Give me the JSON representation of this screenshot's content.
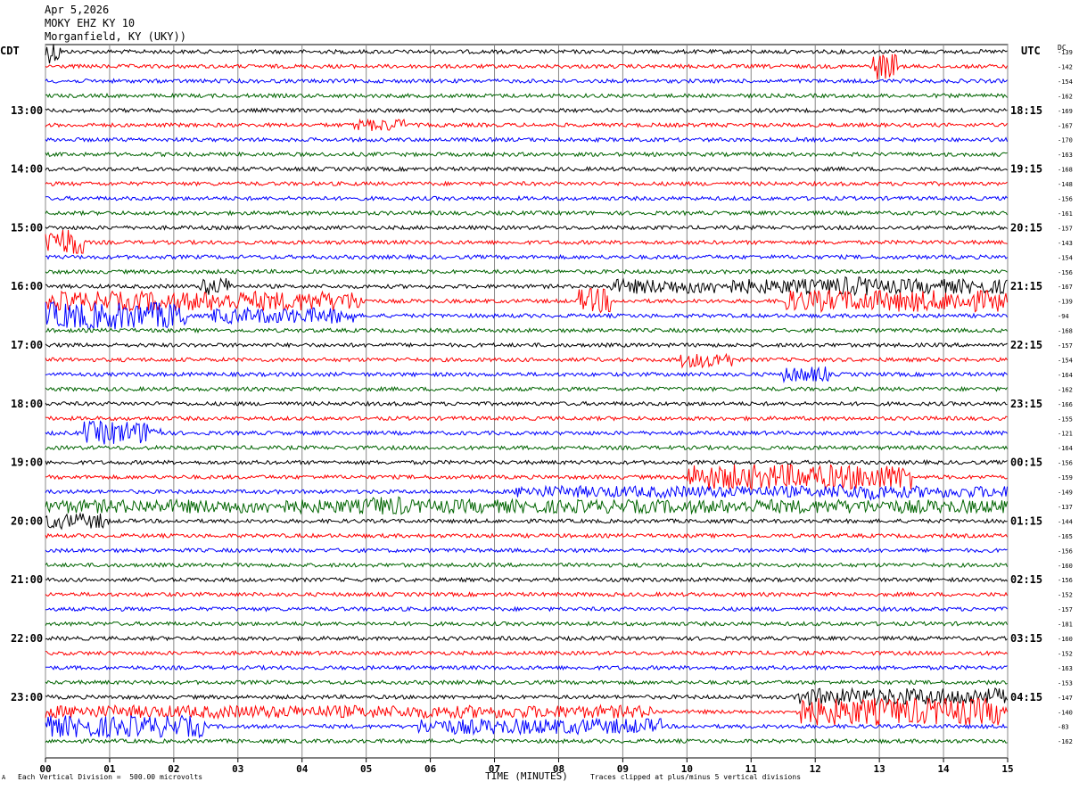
{
  "header": {
    "date": "Apr 5,2026",
    "station": "MOKY EHZ KY 10",
    "location": "Morganfield, KY (UKY))"
  },
  "left_timezone": "CDT",
  "right_timezone": "UTC",
  "dc_label": "DC",
  "footer": {
    "scale_note": "Each Vertical Division =  500.00 microvolts",
    "clip_note": "Traces clipped at plus/minus 5 vertical divisions",
    "corner_mark": "A"
  },
  "chart_data": {
    "type": "helicorder",
    "title": "",
    "xlabel": "TIME (MINUTES)",
    "xlim": [
      0,
      15
    ],
    "x_ticks": [
      "00",
      "01",
      "02",
      "03",
      "04",
      "05",
      "06",
      "07",
      "08",
      "09",
      "10",
      "11",
      "12",
      "13",
      "14",
      "15"
    ],
    "trace_colors": [
      "#000000",
      "#ff0000",
      "#0000ff",
      "#006400"
    ],
    "left_hour_labels": [
      "13:00",
      "14:00",
      "15:00",
      "16:00",
      "17:00",
      "18:00",
      "19:00",
      "20:00",
      "21:00",
      "22:00",
      "23:00"
    ],
    "right_hour_labels": [
      "18:15",
      "19:15",
      "20:15",
      "21:15",
      "22:15",
      "23:15",
      "00:15",
      "01:15",
      "02:15",
      "03:15",
      "04:15"
    ],
    "dc_offsets": [
      "-139",
      "-142",
      "-154",
      "-162",
      "-169",
      "-167",
      "-170",
      "-163",
      "-168",
      "-148",
      "-156",
      "-161",
      "-157",
      "-143",
      "-154",
      "-156",
      "-167",
      "-139",
      "-94",
      "-168",
      "-157",
      "-154",
      "-164",
      "-162",
      "-166",
      "-155",
      "-121",
      "-164",
      "-156",
      "-159",
      "-149",
      "-137",
      "-144",
      "-165",
      "-156",
      "-160",
      "-156",
      "-152",
      "-157",
      "-181",
      "-160",
      "-152",
      "-163",
      "-153",
      "-147",
      "-140",
      "-83",
      "-162"
    ],
    "events": [
      {
        "row": 0,
        "start_min": 0.0,
        "end_min": 0.25,
        "amp": 1.0
      },
      {
        "row": 1,
        "start_min": 12.9,
        "end_min": 13.3,
        "amp": 1.2
      },
      {
        "row": 5,
        "start_min": 4.8,
        "end_min": 5.6,
        "amp": 0.45
      },
      {
        "row": 13,
        "start_min": 0.0,
        "end_min": 0.6,
        "amp": 1.3
      },
      {
        "row": 16,
        "start_min": 2.4,
        "end_min": 2.9,
        "amp": 0.7
      },
      {
        "row": 16,
        "start_min": 8.8,
        "end_min": 15.0,
        "amp": 0.55
      },
      {
        "row": 16,
        "start_min": 12.2,
        "end_min": 12.9,
        "amp": 0.8
      },
      {
        "row": 17,
        "start_min": 0.0,
        "end_min": 5.0,
        "amp": 0.8
      },
      {
        "row": 17,
        "start_min": 8.3,
        "end_min": 8.8,
        "amp": 1.1
      },
      {
        "row": 17,
        "start_min": 11.5,
        "end_min": 15.0,
        "amp": 0.9
      },
      {
        "row": 18,
        "start_min": 0.0,
        "end_min": 2.2,
        "amp": 1.2
      },
      {
        "row": 18,
        "start_min": 2.6,
        "end_min": 4.8,
        "amp": 0.6
      },
      {
        "row": 21,
        "start_min": 9.9,
        "end_min": 10.7,
        "amp": 0.6
      },
      {
        "row": 22,
        "start_min": 11.5,
        "end_min": 12.2,
        "amp": 0.6
      },
      {
        "row": 26,
        "start_min": 0.6,
        "end_min": 1.8,
        "amp": 1.0
      },
      {
        "row": 29,
        "start_min": 10.0,
        "end_min": 13.5,
        "amp": 1.1
      },
      {
        "row": 30,
        "start_min": 7.3,
        "end_min": 15.0,
        "amp": 0.4
      },
      {
        "row": 30,
        "start_min": 12.2,
        "end_min": 13.2,
        "amp": 0.6
      },
      {
        "row": 31,
        "start_min": 0.0,
        "end_min": 15.0,
        "amp": 0.5
      },
      {
        "row": 31,
        "start_min": 5.0,
        "end_min": 5.6,
        "amp": 0.8
      },
      {
        "row": 32,
        "start_min": 0.0,
        "end_min": 1.0,
        "amp": 0.6
      },
      {
        "row": 44,
        "start_min": 11.7,
        "end_min": 15.0,
        "amp": 0.7
      },
      {
        "row": 45,
        "start_min": 0.0,
        "end_min": 9.5,
        "amp": 0.45
      },
      {
        "row": 45,
        "start_min": 11.7,
        "end_min": 15.0,
        "amp": 1.2
      },
      {
        "row": 46,
        "start_min": 0.0,
        "end_min": 2.5,
        "amp": 0.9
      },
      {
        "row": 46,
        "start_min": 5.8,
        "end_min": 9.6,
        "amp": 0.6
      }
    ]
  }
}
